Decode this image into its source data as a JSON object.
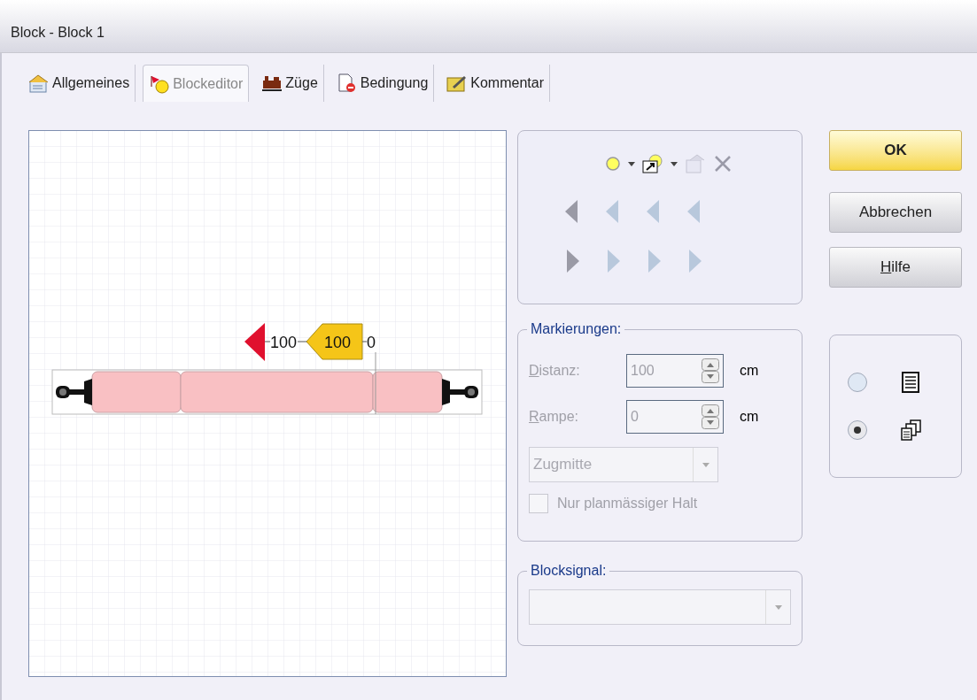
{
  "window": {
    "title": "Block - Block 1"
  },
  "tabs": [
    {
      "label": "Allgemeines",
      "selected": false
    },
    {
      "label": "Blockeditor",
      "selected": true
    },
    {
      "label": "Züge",
      "selected": false
    },
    {
      "label": "Bedingung",
      "selected": false
    },
    {
      "label": "Kommentar",
      "selected": false
    }
  ],
  "diagram": {
    "labels": [
      "100",
      "100",
      "0"
    ]
  },
  "markierungen": {
    "title": "Markierungen:",
    "distanz": {
      "label": "Distanz:",
      "value": "100",
      "unit": "cm"
    },
    "rampe": {
      "label": "Rampe:",
      "value": "0",
      "unit": "cm"
    },
    "position": {
      "value": "Zugmitte"
    },
    "checkbox": {
      "label": "Nur planmässiger Halt",
      "checked": false
    }
  },
  "blocksignal": {
    "title": "Blocksignal:"
  },
  "buttons": [
    {
      "label": "OK",
      "kind": "default"
    },
    {
      "label": "Abbrechen",
      "kind": "normal"
    },
    {
      "label": "Hilfe",
      "kind": "normal"
    }
  ],
  "view_options": [
    {
      "kind": "list",
      "selected": false
    },
    {
      "kind": "pages",
      "selected": true
    }
  ]
}
